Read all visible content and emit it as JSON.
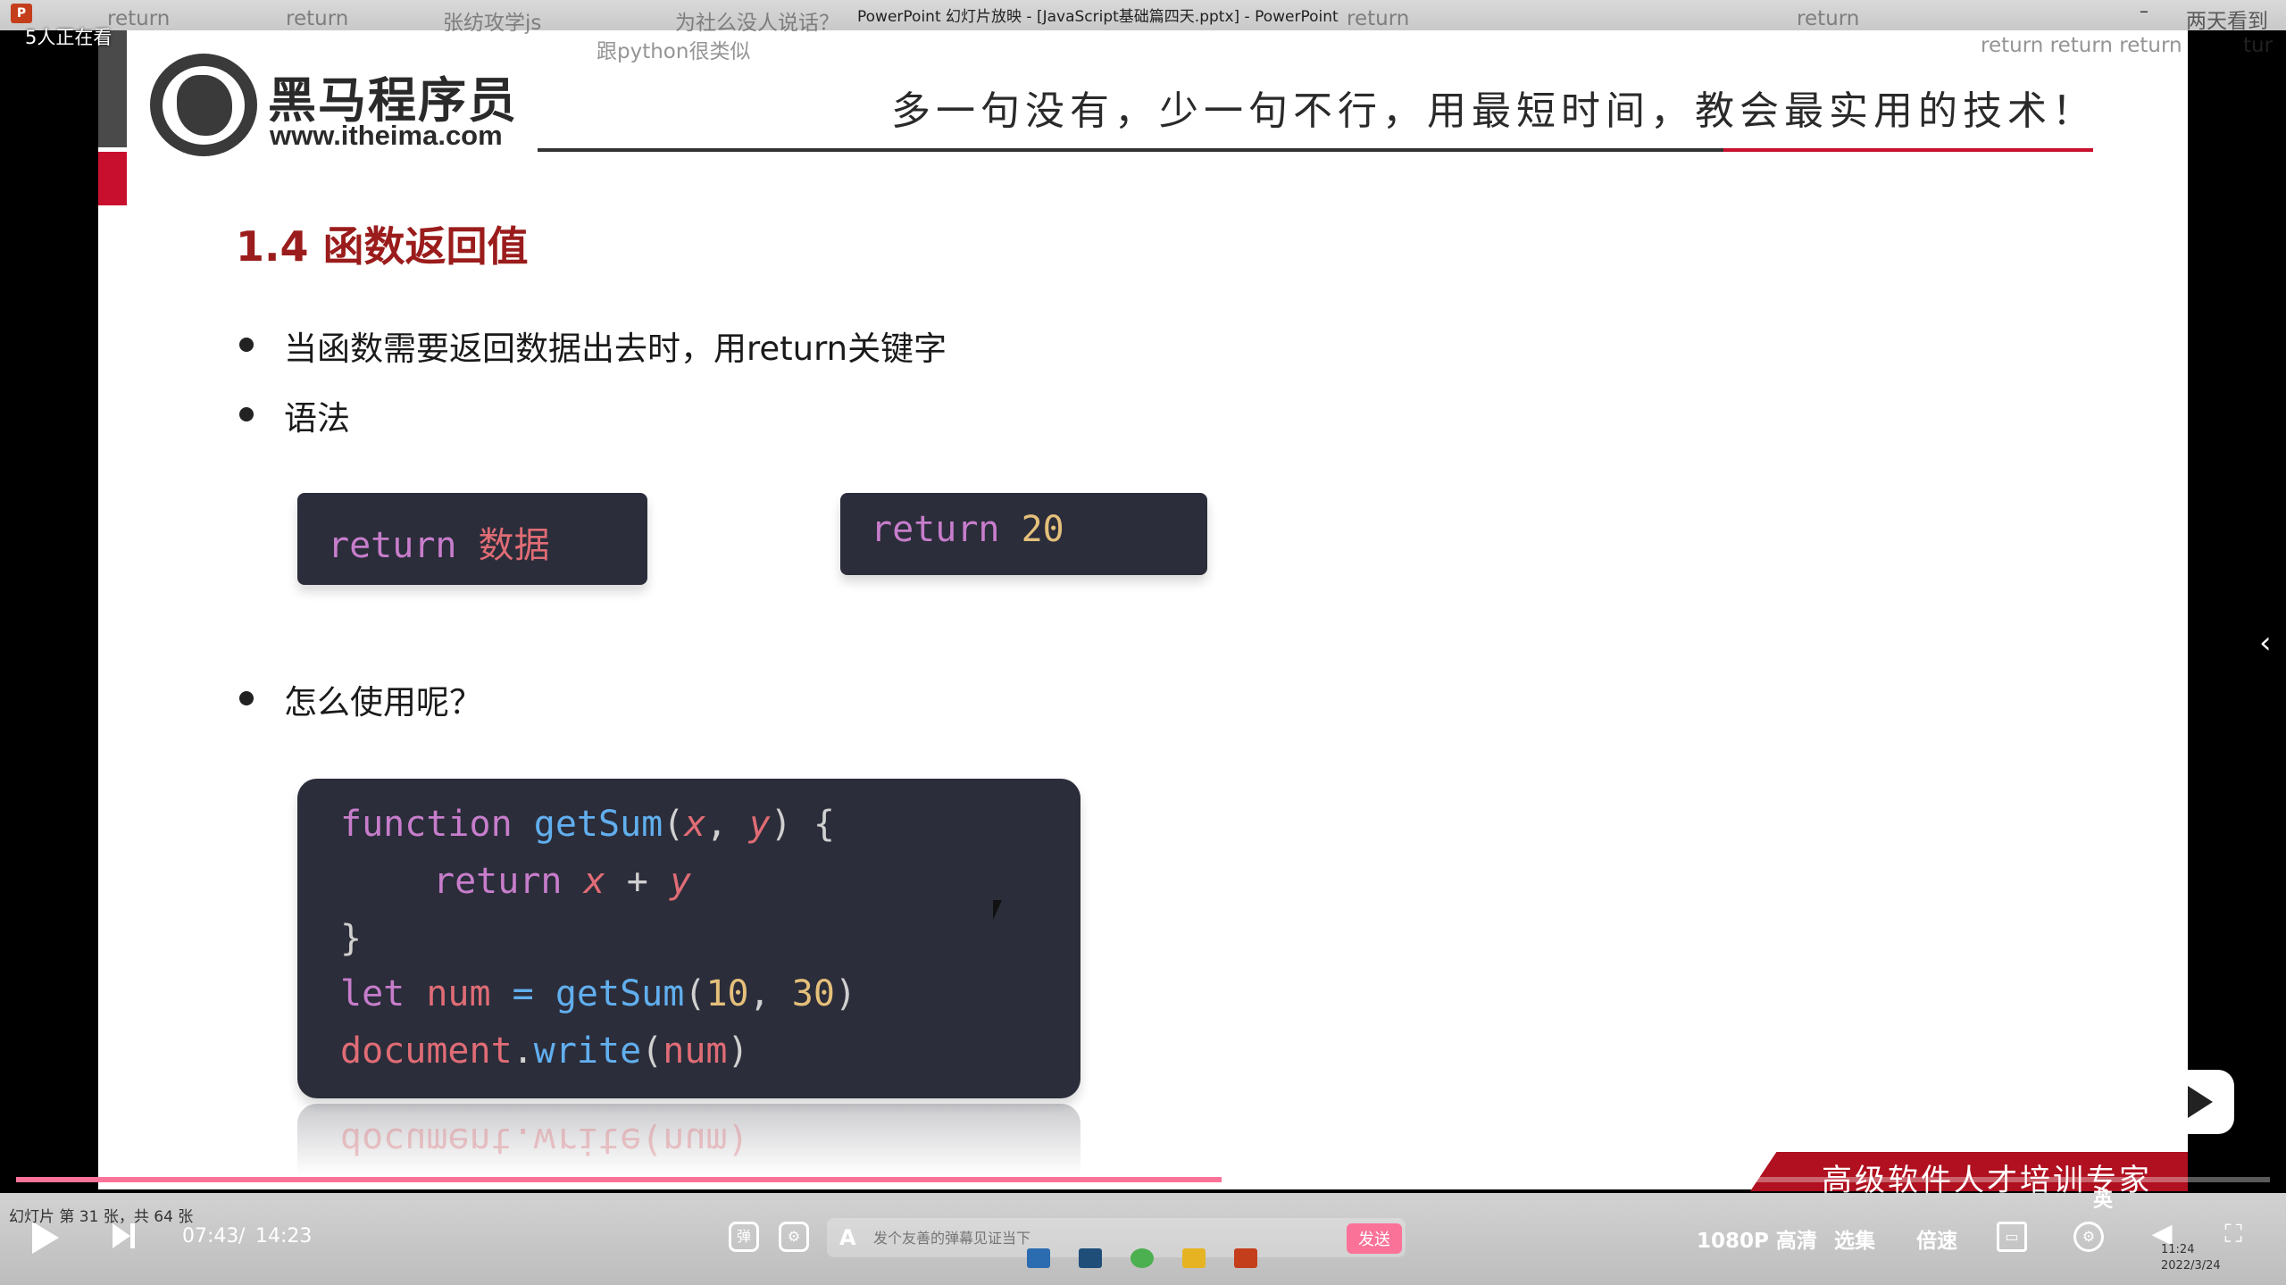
{
  "window": {
    "title": "PowerPoint 幻灯片放映 - [JavaScript基础篇四天.pptx] - PowerPoint",
    "app_icon": "powerpoint-icon",
    "minimize": "–"
  },
  "viewer_count": "5人正在看",
  "danmaku": [
    "return",
    "return",
    "张纺攻学js",
    "为社么没人说话？",
    "跟python很类似",
    "return",
    "return",
    "两天看到",
    "return return return",
    "tur"
  ],
  "slide": {
    "logo": {
      "brand": "黑马程序员",
      "url": "www.itheima.com"
    },
    "slogan": "多一句没有，少一句不行，用最短时间，教会最实用的技术！",
    "section_title": "1.4 函数返回值",
    "bullets": [
      "当函数需要返回数据出去时，用return关键字",
      "语法",
      "怎么使用呢？"
    ],
    "syntax_examples": [
      {
        "keyword": "return",
        "value": "数据"
      },
      {
        "keyword": "return",
        "value": "20"
      }
    ],
    "code": {
      "line1": {
        "kw": "function",
        "fn": "getSum",
        "open": "(",
        "p1": "x",
        "comma": ", ",
        "p2": "y",
        "close": ") {"
      },
      "line2": {
        "kw": "return",
        "a": "x",
        "op": " + ",
        "b": "y"
      },
      "line3": "}",
      "line4": {
        "kw": "let",
        "name": "num",
        "eq": " = ",
        "fn": "getSum",
        "open": "(",
        "a": "10",
        "comma": ", ",
        "b": "30",
        "close": ")"
      },
      "line5": {
        "obj": "document",
        "dot": ".",
        "method": "write",
        "open": "(",
        "arg": "num",
        "close": ")"
      }
    },
    "reflection_text": "document.write(num)"
  },
  "banner": "高级软件人才培训专家",
  "player": {
    "slide_status": "幻灯片 第 31 张，共 64 张",
    "time_current": "07:43",
    "time_sep": "/",
    "time_total": "14:23",
    "progress_fraction": 0.535,
    "danmaku_placeholder": "发个友善的弹幕见证当下",
    "send_label": "发送",
    "quality": "1080P 高清",
    "episodes": "选集",
    "speed": "倍速",
    "ime": "英",
    "clock": "11:24",
    "date": "2022/3/24"
  },
  "colors": {
    "accent": "#fb7299",
    "brand_red": "#c8102e",
    "code_bg": "#2b2d3a"
  }
}
